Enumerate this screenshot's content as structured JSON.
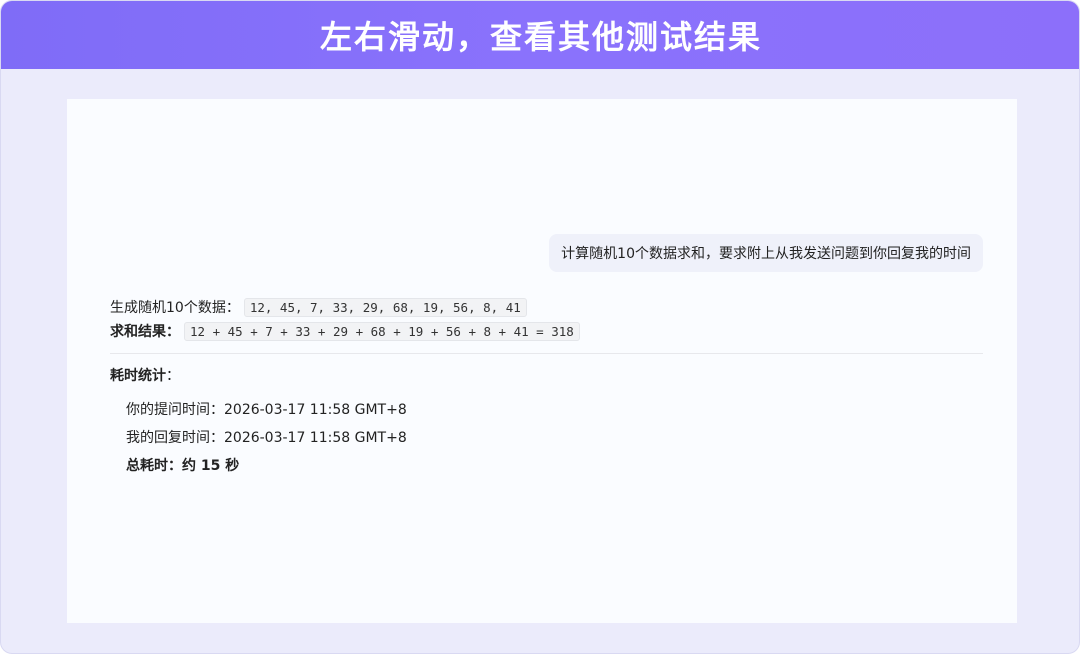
{
  "banner": {
    "title": "左右滑动，查看其他测试结果"
  },
  "chat": {
    "user_message": "计算随机10个数据求和，要求附上从我发送问题到你回复我的时间",
    "reply": {
      "data_label": "生成随机10个数据：",
      "data_values": "12, 45, 7, 33, 29, 68, 19, 56, 8, 41",
      "sum_label": "求和结果：",
      "sum_expression": "12 + 45 + 7 + 33 + 29 + 68 + 19 + 56 + 8 + 41 = 318",
      "stats_heading": "耗时统计",
      "stats_colon": "：",
      "ask_time": "你的提问时间：2026-03-17 11:58 GMT+8",
      "reply_time": "我的回复时间：2026-03-17 11:58 GMT+8",
      "total_time": "总耗时：约 15 秒"
    }
  }
}
